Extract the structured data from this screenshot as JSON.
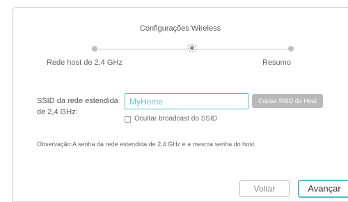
{
  "wizard": {
    "title": "Configurações Wireless",
    "steps": [
      "Rede host de 2,4 GHz",
      "Resumo"
    ]
  },
  "ssid": {
    "label": "SSID da rede estendida de 2,4 GHz:",
    "value": "MyHome",
    "copy_button": "Copiar SSID do Host",
    "hide_broadcast_label": "Ocultar broadcast do SSID",
    "hide_broadcast_checked": false
  },
  "note": "Observação:A senha da rede estendida de 2,4 GHz é a mesma senha do host.",
  "buttons": {
    "back": "Voltar",
    "next": "Avançar"
  },
  "colors": {
    "accent": "#4cbccf",
    "disabled": "#b9b9b9"
  }
}
